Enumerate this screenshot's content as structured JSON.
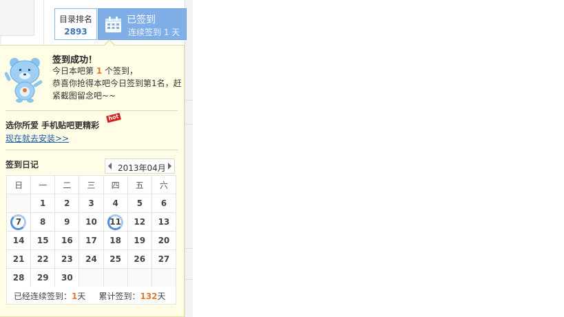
{
  "rank": {
    "label": "目录排名",
    "value": "2893"
  },
  "sign": {
    "status": "已签到",
    "streak_text": "连续签到 1 天"
  },
  "popup": {
    "success_title": "签到成功！",
    "msg_prefix": "今日本吧第",
    "msg_rank": "1",
    "msg_suffix": "个签到，",
    "msg_line2": "恭喜你抢得本吧今日签到第1名，赶",
    "msg_line3": "紧截图留念吧~~",
    "promo_title": "选你所爱  手机贴吧更精彩",
    "hot_badge": "hot",
    "promo_link": "现在就去安装>>",
    "diary_title": "签到日记",
    "month": "2013年04月",
    "weekdays": [
      "日",
      "一",
      "二",
      "三",
      "四",
      "五",
      "六"
    ],
    "weeks": [
      [
        "",
        "1",
        "2",
        "3",
        "4",
        "5",
        "6"
      ],
      [
        "7",
        "8",
        "9",
        "10",
        "11",
        "12",
        "13"
      ],
      [
        "14",
        "15",
        "16",
        "17",
        "18",
        "19",
        "20"
      ],
      [
        "21",
        "22",
        "23",
        "24",
        "25",
        "26",
        "27"
      ],
      [
        "28",
        "29",
        "30",
        "",
        "",
        "",
        ""
      ]
    ],
    "signed_days": [
      "7",
      "11"
    ],
    "summary": {
      "streak_label": "已经连续签到：",
      "streak_value": "1",
      "streak_unit": "天",
      "total_label": "累计签到：",
      "total_value": "132",
      "total_unit": "天"
    }
  },
  "colors": {
    "accent": "#80aee6",
    "highlight": "#e8772c",
    "link": "#1b5aa6",
    "popup_bg": "#fffde6"
  },
  "icons": {
    "sign": "calendar-icon",
    "mascot": "bear-mascot-icon"
  }
}
